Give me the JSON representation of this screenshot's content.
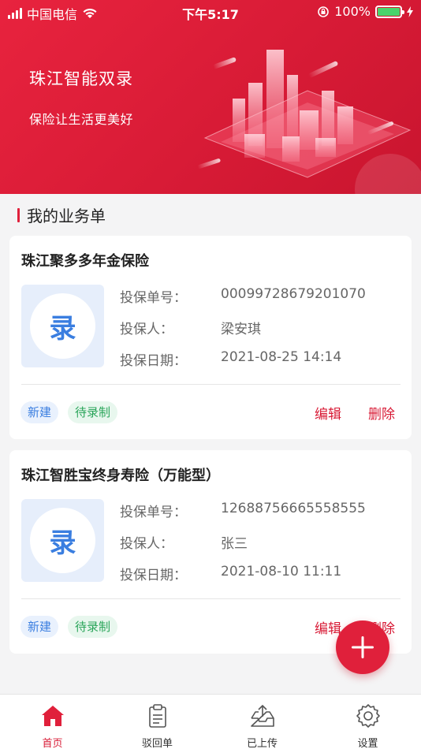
{
  "status_bar": {
    "carrier": "中国电信",
    "time": "下午5:17",
    "battery": "100%"
  },
  "banner": {
    "title": "珠江智能双录",
    "slogan": "保险让生活更美好"
  },
  "section": {
    "title": "我的业务单"
  },
  "orders": [
    {
      "name": "珠江聚多多年金保险",
      "icon_text": "录",
      "policy_label": "投保单号：",
      "policy_no": "00099728679201070",
      "holder_label": "投保人：",
      "holder": "梁安琪",
      "date_label": "投保日期：",
      "date": "2021-08-25 14:14",
      "badge_new": "新建",
      "badge_status": "待录制",
      "edit": "编辑",
      "delete": "删除"
    },
    {
      "name": "珠江智胜宝终身寿险（万能型）",
      "icon_text": "录",
      "policy_label": "投保单号：",
      "policy_no": "12688756665558555",
      "holder_label": "投保人：",
      "holder": "张三",
      "date_label": "投保日期：",
      "date": "2021-08-10 11:11",
      "badge_new": "新建",
      "badge_status": "待录制",
      "edit": "编辑",
      "delete": "删除"
    }
  ],
  "tabs": [
    {
      "label": "首页",
      "icon": "home-icon",
      "active": true
    },
    {
      "label": "驳回单",
      "icon": "clipboard-icon",
      "active": false
    },
    {
      "label": "已上传",
      "icon": "upload-tray-icon",
      "active": false
    },
    {
      "label": "设置",
      "icon": "gear-icon",
      "active": false
    }
  ],
  "colors": {
    "brand": "#e0203b",
    "blue": "#3a7ee0",
    "green": "#2aa55a"
  }
}
